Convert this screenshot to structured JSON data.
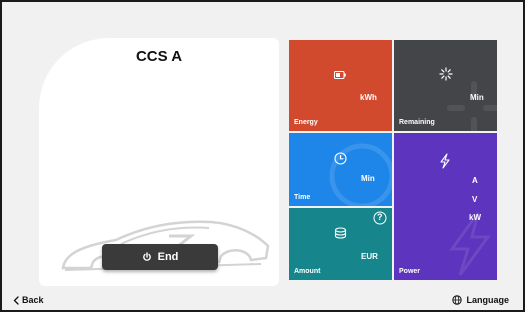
{
  "connector": {
    "title": "CCS A"
  },
  "controls": {
    "end_label": "End"
  },
  "tiles": {
    "energy": {
      "unit": "kWh",
      "label": "Energy"
    },
    "remaining": {
      "unit": "Min",
      "label": "Remaining"
    },
    "time": {
      "unit": "Min",
      "label": "Time"
    },
    "amount": {
      "unit": "EUR",
      "label": "Amount",
      "help": "?"
    },
    "power": {
      "unit_a": "A",
      "unit_v": "V",
      "unit_kw": "kW",
      "label": "Power"
    }
  },
  "footer": {
    "back_label": "Back",
    "language_label": "Language"
  },
  "colors": {
    "energy": "#d24a2d",
    "remaining": "#434549",
    "time": "#1e86e9",
    "amount": "#17868c",
    "power": "#5c34bd",
    "end_button": "#3a3a3a"
  },
  "icons": {
    "energy": "battery-icon",
    "remaining": "loading-spinner-icon",
    "time": "clock-icon",
    "amount": "coins-icon",
    "power": "lightning-icon",
    "end": "power-icon",
    "back": "chevron-left-icon",
    "language": "globe-icon",
    "help": "help-icon"
  }
}
